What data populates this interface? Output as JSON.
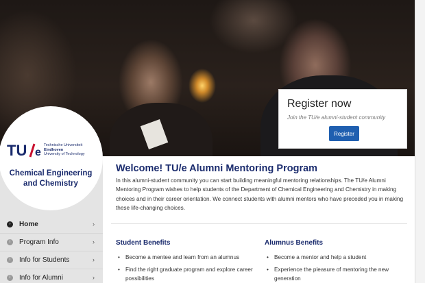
{
  "register": {
    "title": "Register now",
    "subtitle": "Join the TU/e alumni-student community",
    "button": "Register"
  },
  "logo": {
    "mark": "TU/e",
    "university_line1": "Technische Universiteit",
    "university_line2": "Eindhoven",
    "university_line3": "University of Technology",
    "department": "Chemical Engineering and Chemistry"
  },
  "nav": {
    "items": [
      {
        "label": "Home",
        "icon": "circle-arrow-icon"
      },
      {
        "label": "Program Info",
        "icon": "info-icon"
      },
      {
        "label": "Info for Students",
        "icon": "info-icon"
      },
      {
        "label": "Info for Alumni",
        "icon": "info-icon"
      }
    ],
    "chevron": "›"
  },
  "main": {
    "title": "Welcome! TU/e Alumni Mentoring Program",
    "intro": "In this alumni-student community you can start building meaningful mentoring relationships. The TU/e Alumni Mentoring Program wishes to help students of the Department of Chemical Engineering and Chemistry in making choices and in their career orientation. We connect students with alumni mentors who have preceded you in making these life-changing choices.",
    "student_benefits": {
      "title": "Student Benefits",
      "items": [
        "Become a mentee and learn from an alumnus",
        "Find the right graduate program and explore career possibilities"
      ]
    },
    "alumnus_benefits": {
      "title": "Alumnus Benefits",
      "items": [
        "Become a mentor and help a student",
        "Experience the pleasure of mentoring the new generation"
      ]
    }
  },
  "colors": {
    "brand_blue": "#1a2b6d",
    "button_blue": "#1f5fb0",
    "logo_red": "#c8102e"
  }
}
